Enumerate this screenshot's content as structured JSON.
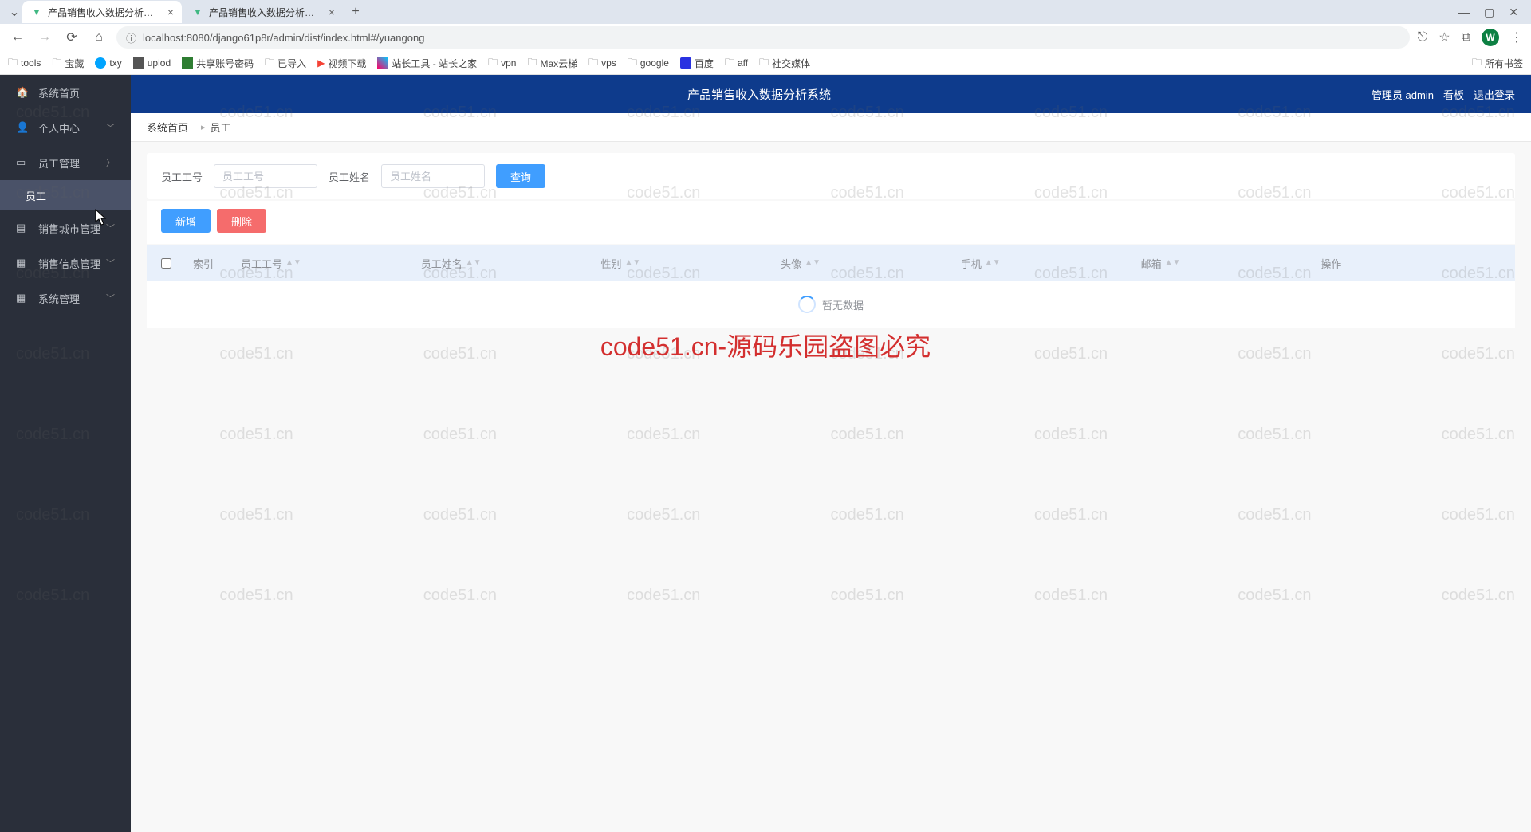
{
  "browser": {
    "tabs": [
      {
        "title": "产品销售收入数据分析系统",
        "active": true
      },
      {
        "title": "产品销售收入数据分析系统",
        "active": false
      }
    ],
    "url": "localhost:8080/django61p8r/admin/dist/index.html#/yuangong",
    "avatar_letter": "W",
    "bookmarks": [
      {
        "label": "tools",
        "icon": "folder"
      },
      {
        "label": "宝藏",
        "icon": "folder"
      },
      {
        "label": "txy",
        "icon": "txy"
      },
      {
        "label": "uplod",
        "icon": "uplod"
      },
      {
        "label": "共享账号密码",
        "icon": "bt"
      },
      {
        "label": "已导入",
        "icon": "folder"
      },
      {
        "label": "视频下载",
        "icon": "video"
      },
      {
        "label": "站长工具 - 站长之家",
        "icon": "zz"
      },
      {
        "label": "vpn",
        "icon": "folder"
      },
      {
        "label": "Max云梯",
        "icon": "folder"
      },
      {
        "label": "vps",
        "icon": "folder"
      },
      {
        "label": "google",
        "icon": "folder"
      },
      {
        "label": "百度",
        "icon": "baidu"
      },
      {
        "label": "aff",
        "icon": "folder"
      },
      {
        "label": "社交媒体",
        "icon": "folder"
      }
    ],
    "all_bookmarks": "所有书签"
  },
  "app": {
    "topbar_title": "产品销售收入数据分析系统",
    "admin_label": "管理员 admin",
    "kanban": "看板",
    "logout": "退出登录"
  },
  "sidebar": {
    "items": [
      {
        "label": "系统首页",
        "icon": "home",
        "expandable": false
      },
      {
        "label": "个人中心",
        "icon": "user",
        "expandable": true,
        "expanded": false
      },
      {
        "label": "员工管理",
        "icon": "staff",
        "expandable": true,
        "expanded": true,
        "children": [
          {
            "label": "员工",
            "active": true
          }
        ]
      },
      {
        "label": "销售城市管理",
        "icon": "city",
        "expandable": true,
        "expanded": false
      },
      {
        "label": "销售信息管理",
        "icon": "info",
        "expandable": true,
        "expanded": false
      },
      {
        "label": "系统管理",
        "icon": "sys",
        "expandable": true,
        "expanded": false
      }
    ]
  },
  "breadcrumb": {
    "home": "系统首页",
    "current": "员工"
  },
  "search": {
    "emp_id_label": "员工工号",
    "emp_id_placeholder": "员工工号",
    "emp_name_label": "员工姓名",
    "emp_name_placeholder": "员工姓名",
    "query_btn": "查询"
  },
  "actions": {
    "add": "新增",
    "delete": "删除"
  },
  "table": {
    "headers": [
      "索引",
      "员工工号",
      "员工姓名",
      "性别",
      "头像",
      "手机",
      "邮箱",
      "操作"
    ],
    "empty_text": "暂无数据"
  },
  "watermark_text": "code51.cn",
  "watermark_main": "code51.cn-源码乐园盗图必究"
}
